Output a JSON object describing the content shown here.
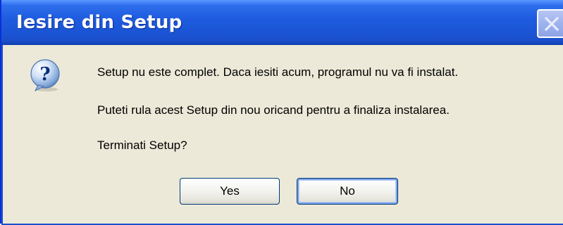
{
  "dialog": {
    "title": "Iesire din Setup",
    "icon": "question-icon",
    "message_line1": "Setup nu este complet. Daca iesiti acum, programul nu va fi instalat.",
    "message_line2": "Puteti rula acest Setup din nou oricand pentru a finaliza instalarea.",
    "message_line3": "Terminati Setup?",
    "yes_label": "Yes",
    "no_label": "No",
    "focused_button": "No"
  },
  "colors": {
    "titlebar": "#1f5ce0",
    "dialog_background": "#ece9d8",
    "close_button": "#9eb2ee"
  }
}
